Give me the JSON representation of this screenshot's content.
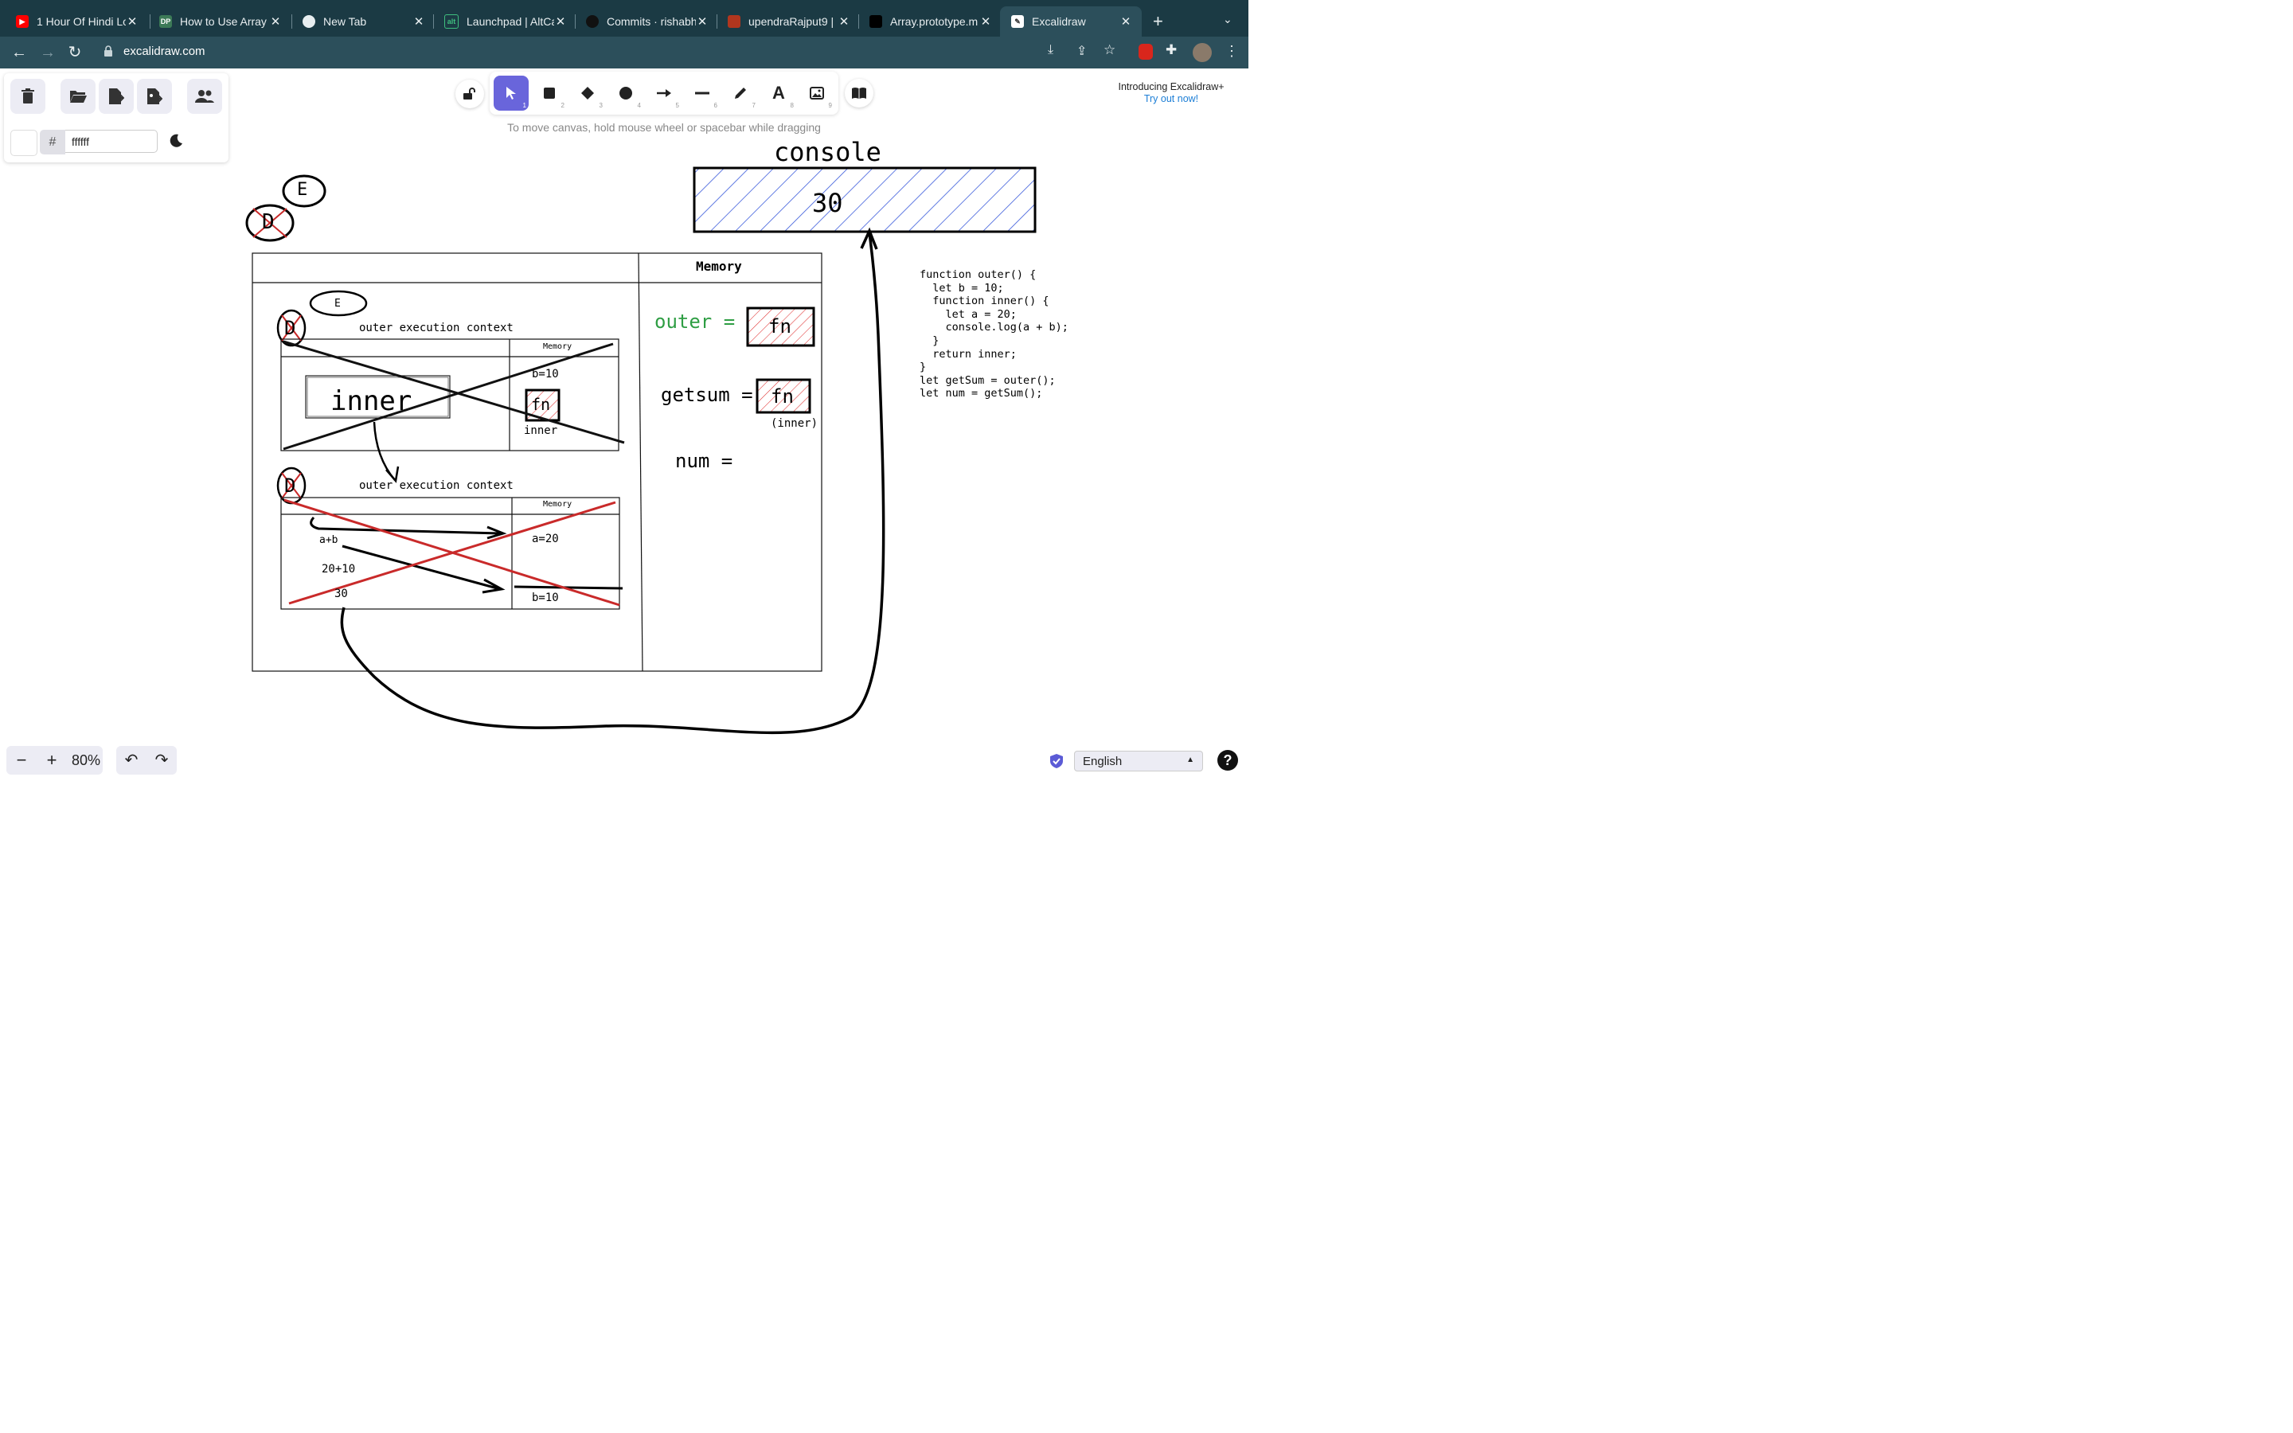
{
  "browser": {
    "tabs": [
      {
        "title": "1 Hour Of Hindi Lo",
        "favicon": "youtube-icon"
      },
      {
        "title": "How to Use Array",
        "favicon": "dp-icon"
      },
      {
        "title": "New Tab",
        "favicon": "chrome-icon"
      },
      {
        "title": "Launchpad | AltCa",
        "favicon": "altcampus-icon"
      },
      {
        "title": "Commits · rishabh",
        "favicon": "github-icon"
      },
      {
        "title": "upendraRajput9 |",
        "favicon": "codewars-icon"
      },
      {
        "title": "Array.prototype.m",
        "favicon": "mdn-icon"
      },
      {
        "title": "Excalidraw",
        "favicon": "excalidraw-icon",
        "active": true
      }
    ],
    "url": "excalidraw.com"
  },
  "toolbar": {
    "tools": [
      {
        "name": "selection",
        "shortcut": "1"
      },
      {
        "name": "rectangle",
        "shortcut": "2"
      },
      {
        "name": "diamond",
        "shortcut": "3"
      },
      {
        "name": "ellipse",
        "shortcut": "4"
      },
      {
        "name": "arrow",
        "shortcut": "5"
      },
      {
        "name": "line",
        "shortcut": "6"
      },
      {
        "name": "draw",
        "shortcut": "7"
      },
      {
        "name": "text",
        "shortcut": "8"
      },
      {
        "name": "image",
        "shortcut": "9"
      }
    ],
    "hint": "To move canvas, hold mouse wheel or spacebar while dragging"
  },
  "left_panel": {
    "hash": "#",
    "bg_color": "ffffff"
  },
  "promo": {
    "line1": "Introducing Excalidraw+",
    "link": "Try out now!"
  },
  "footer": {
    "zoom": "80%",
    "language": "English"
  },
  "canvas": {
    "console_title": "console",
    "console_value": "30",
    "stack_E_top": "E",
    "stack_D_top": "D",
    "memory_header": "Memory",
    "memory_outer": "outer =",
    "memory_outer_fn": "fn",
    "memory_getsum": "getsum =",
    "memory_getsum_fn": "fn",
    "memory_inner_note": "(inner)",
    "memory_num": "num =",
    "ec1": {
      "E": "E",
      "D": "D",
      "title": "outer execution context",
      "memory": "Memory",
      "code": "inner",
      "b": "b=10",
      "fn": "fn",
      "fn_label": "inner"
    },
    "ec2": {
      "D": "D",
      "title": "outer execution context",
      "memory": "Memory",
      "line1": "a+b",
      "line2": "20+10",
      "line3": "30",
      "a": "a=20",
      "b": "b=10"
    },
    "code": [
      "function outer() {",
      "  let b = 10;",
      "  function inner() {",
      "    let a = 20;",
      "    console.log(a + b);",
      "  }",
      "  return inner;",
      "}",
      "let getSum = outer();",
      "let num = getSum();"
    ]
  }
}
